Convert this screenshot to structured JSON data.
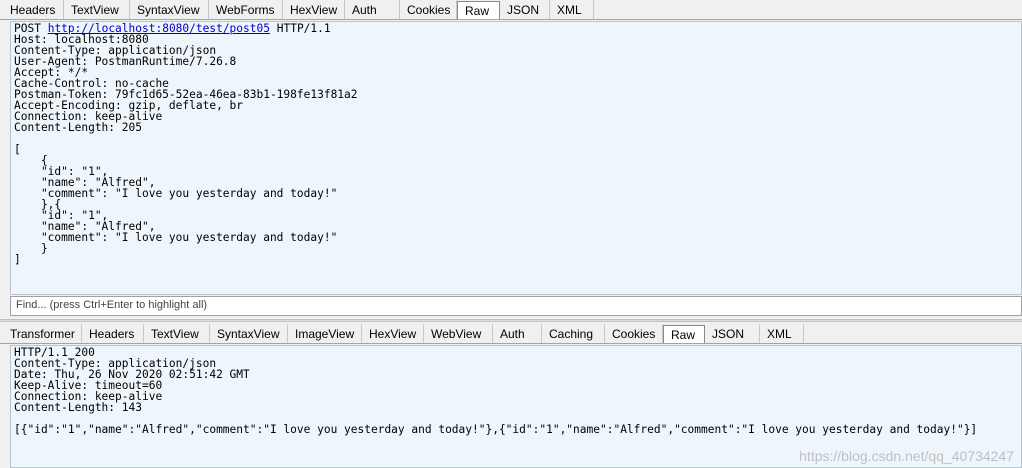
{
  "request": {
    "tabs": [
      "Headers",
      "TextView",
      "SyntaxView",
      "WebForms",
      "HexView",
      "Auth",
      "Cookies",
      "Raw",
      "JSON",
      "XML"
    ],
    "active_tab": "Raw",
    "method": "POST",
    "url": "http://localhost:8080/test/post05",
    "protocol": "HTTP/1.1",
    "raw_after_request_line": "Host: localhost:8080\nContent-Type: application/json\nUser-Agent: PostmanRuntime/7.26.8\nAccept: */*\nCache-Control: no-cache\nPostman-Token: 79fc1d65-52ea-46ea-83b1-198fe13f81a2\nAccept-Encoding: gzip, deflate, br\nConnection: keep-alive\nContent-Length: 205\n\n[\n    {\n    \"id\": \"1\",\n    \"name\": \"Alfred\",\n    \"comment\": \"I love you yesterday and today!\"\n    },{\n    \"id\": \"1\",\n    \"name\": \"Alfred\",\n    \"comment\": \"I love you yesterday and today!\"\n    }\n]",
    "find_placeholder": "Find... (press Ctrl+Enter to highlight all)"
  },
  "response": {
    "tabs": [
      "Transformer",
      "Headers",
      "TextView",
      "SyntaxView",
      "ImageView",
      "HexView",
      "WebView",
      "Auth",
      "Caching",
      "Cookies",
      "Raw",
      "JSON",
      "XML"
    ],
    "active_tab": "Raw",
    "raw": "HTTP/1.1 200\nContent-Type: application/json\nDate: Thu, 26 Nov 2020 02:51:42 GMT\nKeep-Alive: timeout=60\nConnection: keep-alive\nContent-Length: 143\n\n[{\"id\":\"1\",\"name\":\"Alfred\",\"comment\":\"I love you yesterday and today!\"},{\"id\":\"1\",\"name\":\"Alfred\",\"comment\":\"I love you yesterday and today!\"}]"
  },
  "watermark": "https://blog.csdn.net/qq_40734247"
}
